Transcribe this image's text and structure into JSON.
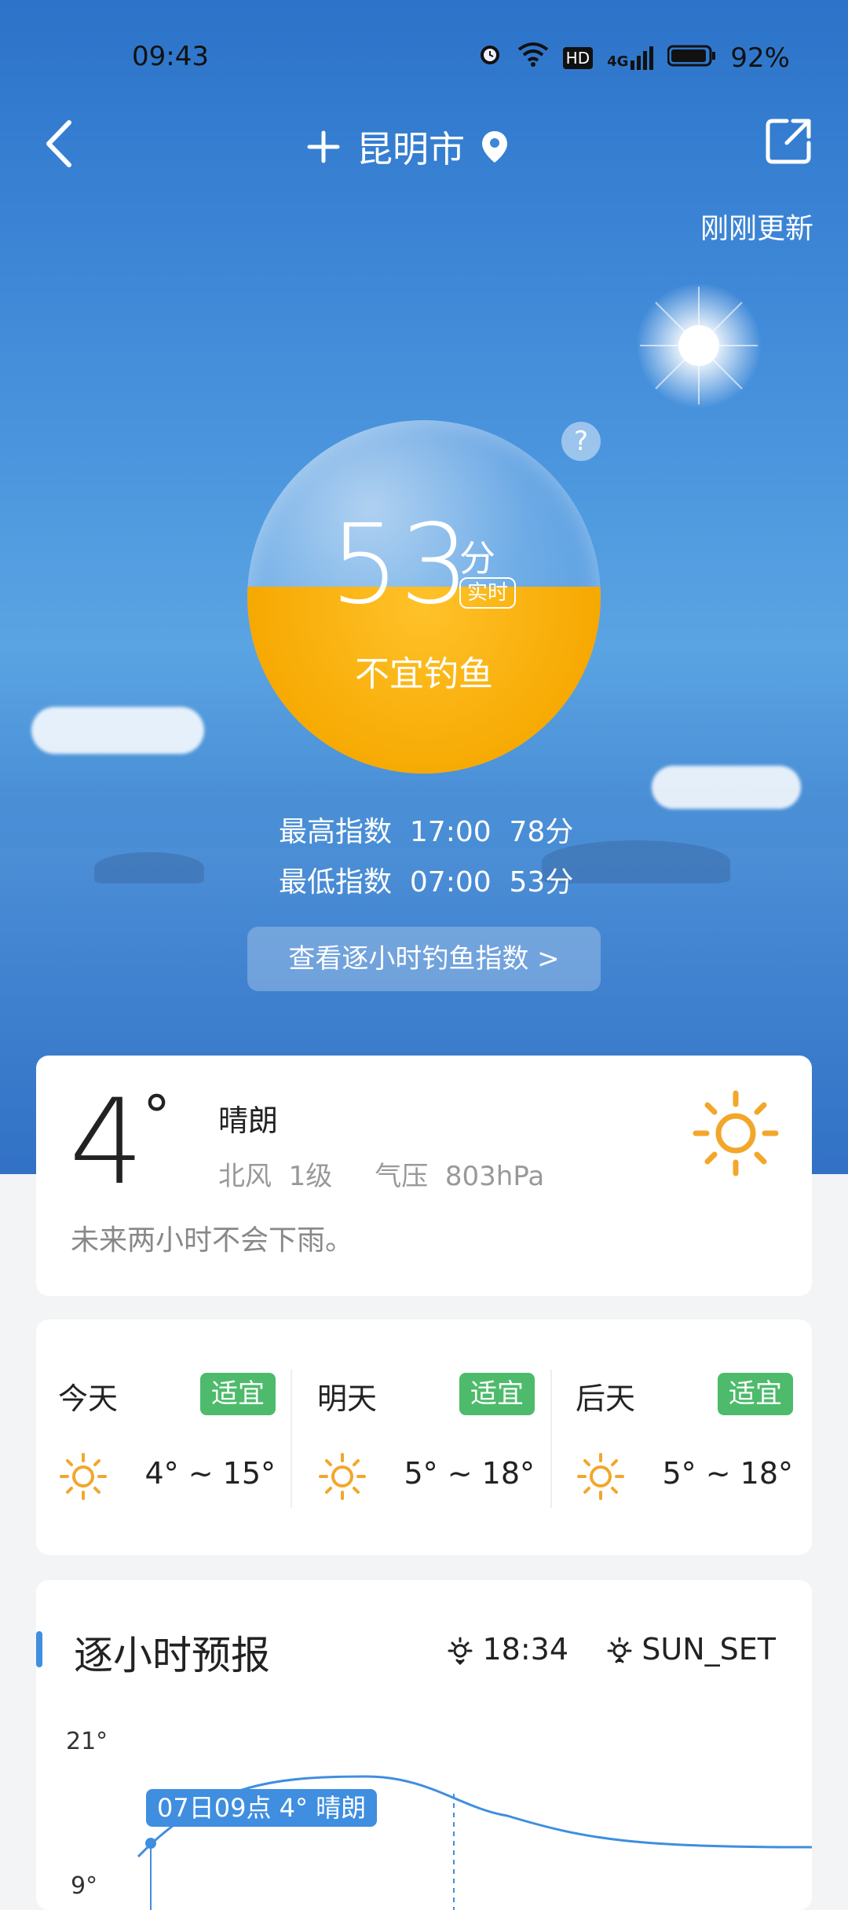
{
  "status_bar": {
    "time": "09:43",
    "icons": [
      "alarm-icon",
      "wifi-icon",
      "hd-icon",
      "4g-signal-icon",
      "battery-icon"
    ],
    "hd": "HD",
    "network": "4G",
    "battery": "92%"
  },
  "header": {
    "city": "昆明市",
    "updated": "刚刚更新"
  },
  "index": {
    "score": "53",
    "unit": "分",
    "realtime": "实时",
    "verdict": "不宜钓鱼",
    "level_percent": 53
  },
  "stats": {
    "max": "最高指数  17:00  78分",
    "min": "最低指数  07:00  53分"
  },
  "hourly_button": "查看逐小时钓鱼指数  >",
  "current": {
    "temp": "4",
    "degree": "°",
    "condition": "晴朗",
    "wind": "北风  1级     气压  803hPa",
    "rain": "未来两小时不会下雨。"
  },
  "days": [
    {
      "name": "今天",
      "badge": "适宜",
      "range": "4° ~ 15°"
    },
    {
      "name": "明天",
      "badge": "适宜",
      "range": "5° ~ 18°"
    },
    {
      "name": "后天",
      "badge": "适宜",
      "range": "5° ~ 18°"
    }
  ],
  "hourly": {
    "title": "逐小时预报",
    "sunrise": "18:34",
    "sunset": "SUN_SET",
    "y_top": "21°",
    "y_bottom": "9°",
    "tooltip": "07日09点 4° 晴朗"
  },
  "colors": {
    "accent": "#3f8ee0",
    "badge": "#4dbb6b",
    "index_fill": "#f6a800",
    "sun": "#f2a72b"
  }
}
